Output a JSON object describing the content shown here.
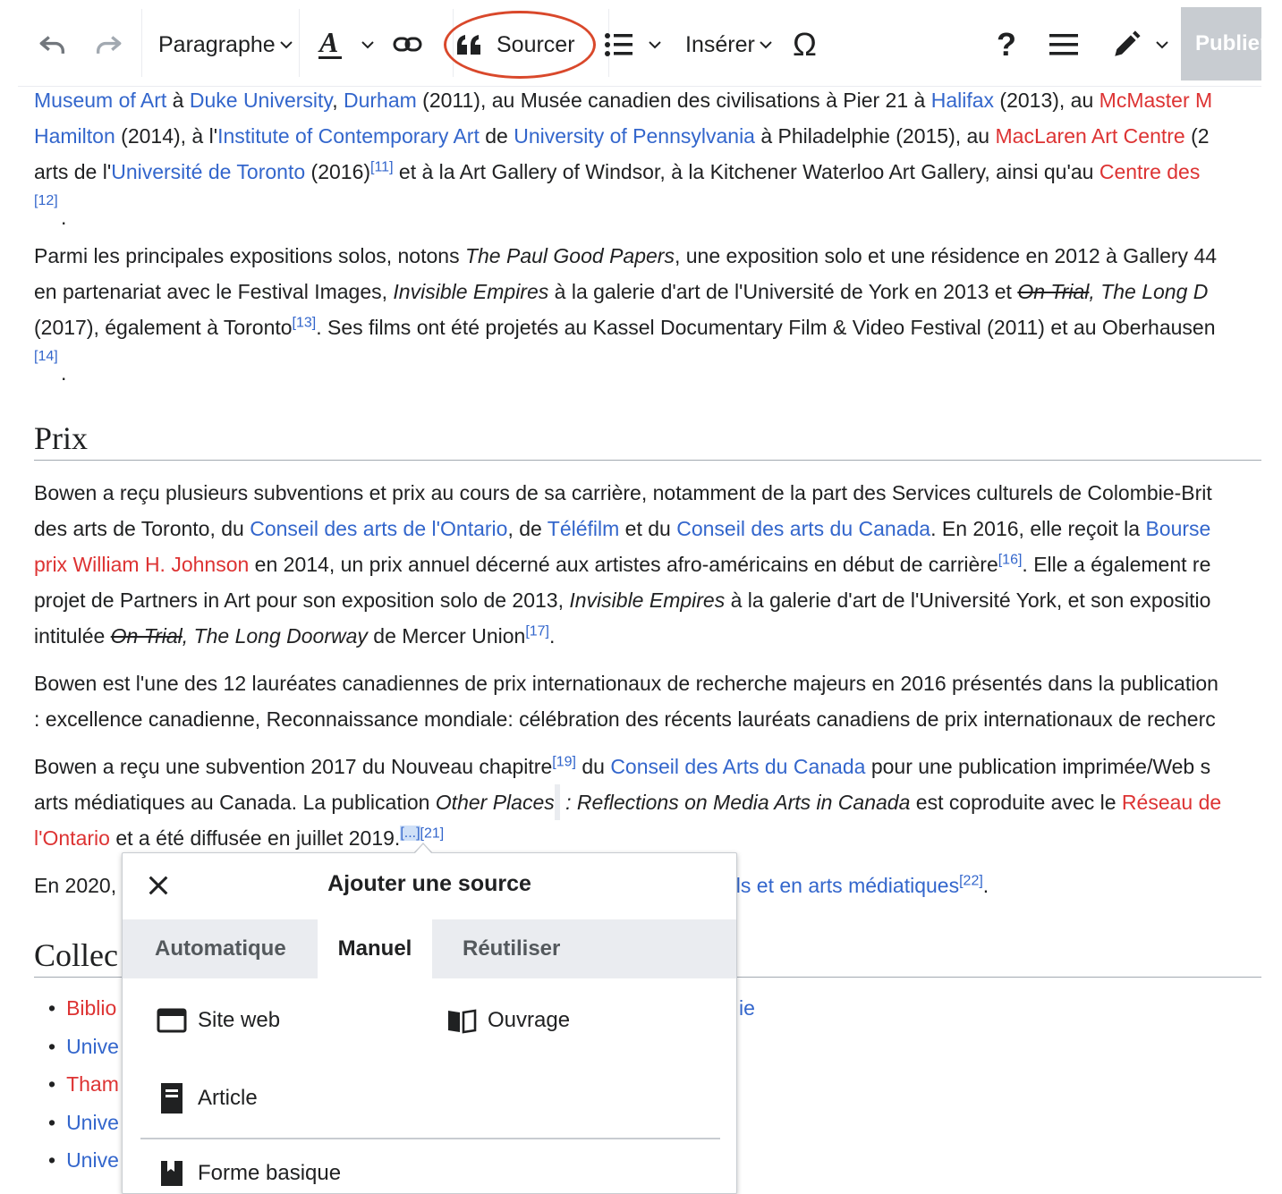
{
  "toolbar": {
    "paragraph_label": "Paragraphe",
    "cite_label": "Sourcer",
    "insert_label": "Insérer",
    "special_char": "Ω",
    "help_label": "?",
    "publish_label": "Publier"
  },
  "content": {
    "p1": {
      "l1": {
        "a": "Museum of Art",
        "t1": " à ",
        "b": "Duke University",
        "t2": ", ",
        "c": "Durham",
        "t3": " (2011), au Musée canadien des civilisations à Pier 21 à ",
        "d": "Halifax",
        "t4": " (2013), au ",
        "e": "McMaster M"
      },
      "l2": {
        "a": "Hamilton",
        "t1": " (2014), à l'",
        "b": "Institute of Contemporary Art",
        "t2": " de ",
        "c": "University of Pennsylvania",
        "t3": " à Philadelphie (2015), au ",
        "d": "MacLaren Art Centre",
        "t4": " (2"
      },
      "l3": {
        "t1": "arts de l'",
        "a": "Université de Toronto",
        "t2": " (2016)",
        "fn": "[11]",
        "t3": " et à la Art Gallery of Windsor, à la Kitchener Waterloo Art Gallery, ainsi qu'au ",
        "b": "Centre des"
      },
      "fn12": "[12]"
    },
    "p2": {
      "l1": {
        "t1": "Parmi les principales expositions solos, notons ",
        "i1": "The Paul Good Papers",
        "t2": ", une exposition solo et une résidence en 2012 à Gallery 44"
      },
      "l2": {
        "t1": "en partenariat avec le Festival Images, ",
        "i1": "Invisible Empires",
        "t2": " à la galerie d'art de l'Université de York en 2013 et ",
        "s1": "On Trial",
        "i2": ", The Long D"
      },
      "l3": {
        "t1": "(2017), également à Toronto",
        "fn": "[13]",
        "t2": ". Ses films ont été projetés au Kassel Documentary Film & Video Festival (2011) et au Oberhausen"
      },
      "fn14": "[14]"
    },
    "prix_heading": "Prix",
    "p3": {
      "l1": {
        "t1": "Bowen a reçu plusieurs subventions et prix au cours de sa carrière, notamment de la part des Services culturels de Colombie-Brit"
      },
      "l2": {
        "t1": "des arts de Toronto, du ",
        "a": "Conseil des arts de l'Ontario",
        "t2": ", de ",
        "b": "Téléfilm",
        "t3": " et du ",
        "c": "Conseil des arts du Canada",
        "t4": ". En 2016, elle reçoit la ",
        "d": "Bourse"
      },
      "l3": {
        "a": "prix William H. Johnson",
        "t1": " en 2014, un prix annuel décerné aux artistes afro-américains en début de carrière",
        "fn": "[16]",
        "t2": ". Elle a également re"
      },
      "l4": {
        "t1": "projet de Partners in Art pour son exposition solo de 2013, ",
        "i1": "Invisible Empires",
        "t2": " à la galerie d'art de l'Université York, et son expositio"
      },
      "l5": {
        "t1": "intitulée ",
        "s1": "On Trial",
        "i1": ", The Long Doorway",
        "t2": " de Mercer Union",
        "fn": "[17]",
        "t3": "."
      }
    },
    "p4": {
      "l1": "Bowen est l'une des 12 lauréates canadiennes de prix internationaux de recherche majeurs en 2016 présentés dans la publication",
      "l2": ": excellence canadienne, Reconnaissance mondiale: célébration des récents lauréats canadiens de prix internationaux de recherc"
    },
    "p5": {
      "l1": {
        "t1": "Bowen a reçu une subvention 2017 du Nouveau chapitre",
        "fn": "[19]",
        "t2": " du ",
        "a": "Conseil des Arts du Canada",
        "t3": " pour une publication imprimée/Web s"
      },
      "l2": {
        "t1": "arts médiatiques au Canada. La publication ",
        "i1": "Other Places",
        "t2": " : Reflections on Media Arts in Canada",
        "t3": " est coproduite avec le ",
        "a": "Réseau de"
      },
      "l3": {
        "a": "l'Ontario",
        "t1": " et a été diffusée en juillet 2019.",
        "fn1": "[...]",
        "fn2": "[21]"
      }
    },
    "p6": {
      "t1": "En 2020,",
      "a": "els et en arts médiatiques",
      "fn": "[22]",
      "t2": "."
    },
    "collections_heading": "Collec",
    "list": [
      "Biblio",
      "Unive",
      "Tham",
      "Unive",
      "Unive"
    ],
    "list_extra": "ie"
  },
  "dialog": {
    "title": "Ajouter une source",
    "tabs": [
      "Automatique",
      "Manuel",
      "Réutiliser"
    ],
    "active_tab": "Manuel",
    "options": {
      "website": "Site web",
      "book": "Ouvrage",
      "article": "Article",
      "basic": "Forme basique"
    }
  },
  "colors": {
    "link": "#3366cc",
    "redlink": "#d33",
    "highlight": "#d9482b"
  }
}
